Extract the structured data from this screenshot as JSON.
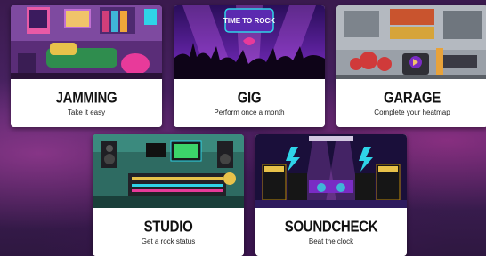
{
  "cards": [
    {
      "title": "JAMMING",
      "subtitle": "Take it easy"
    },
    {
      "title": "GIG",
      "subtitle": "Perform once a month",
      "logo_text": "TIME TO ROCK"
    },
    {
      "title": "GARAGE",
      "subtitle": "Complete your heatmap"
    },
    {
      "title": "STUDIO",
      "subtitle": "Get a rock status"
    },
    {
      "title": "SOUNDCHECK",
      "subtitle": "Beat the clock"
    }
  ],
  "colors": {
    "background": "#3a1a4e",
    "card": "#ffffff",
    "title_text": "#111111",
    "accent_purple": "#7a2cc4",
    "accent_cyan": "#2fd4e8",
    "accent_pink": "#e83a9a"
  }
}
